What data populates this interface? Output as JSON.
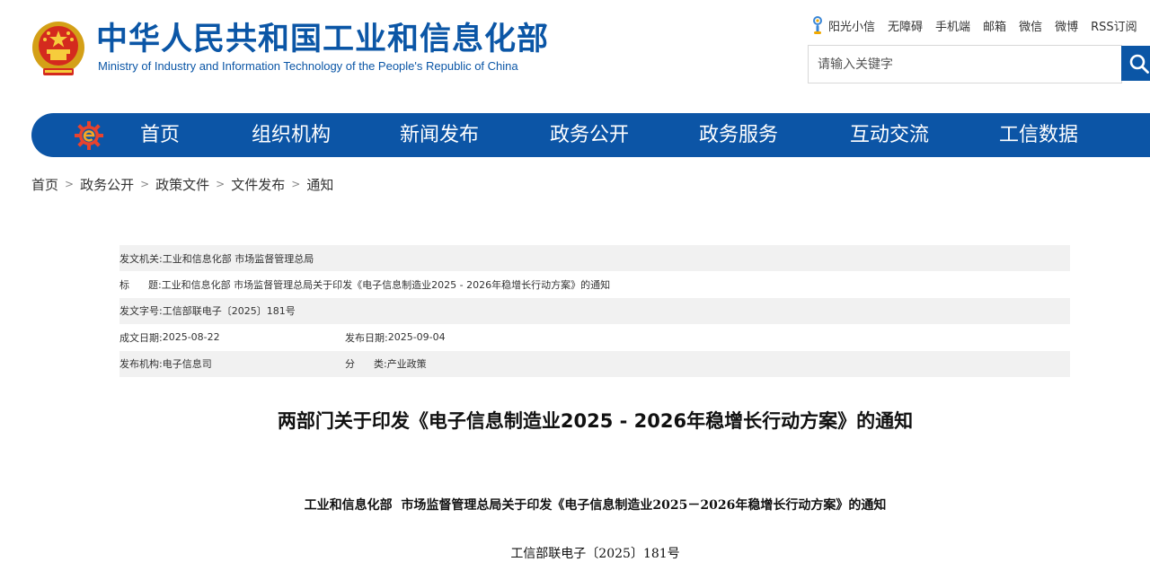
{
  "header": {
    "title": "中华人民共和国工业和信息化部",
    "subtitle": "Ministry of Industry and Information Technology of the People's Republic of China",
    "brand_color": "#0b56a6",
    "emblem_icon": "national-emblem-icon"
  },
  "top_links": [
    {
      "label": "阳光小信",
      "icon": "sun-mascot-icon"
    },
    {
      "label": "无障碍"
    },
    {
      "label": "手机端"
    },
    {
      "label": "邮箱"
    },
    {
      "label": "微信"
    },
    {
      "label": "微博"
    },
    {
      "label": "RSS订阅"
    }
  ],
  "search": {
    "placeholder": "请输入关键字",
    "value": "",
    "button_icon": "search-icon"
  },
  "nav": {
    "logo_icon": "e-gear-logo-icon",
    "background": "#0c55a6",
    "items": [
      {
        "label": "首页"
      },
      {
        "label": "组织机构"
      },
      {
        "label": "新闻发布"
      },
      {
        "label": "政务公开"
      },
      {
        "label": "政务服务"
      },
      {
        "label": "互动交流"
      },
      {
        "label": "工信数据"
      }
    ]
  },
  "breadcrumb": {
    "separator": ">",
    "items": [
      "首页",
      "政务公开",
      "政策文件",
      "文件发布",
      "通知"
    ]
  },
  "meta": {
    "issuer_key": "发文机关:",
    "issuer_value": "工业和信息化部 市场监督管理总局",
    "title_key": "标      题:",
    "title_value": "工业和信息化部 市场监督管理总局关于印发《电子信息制造业2025 - 2026年稳增长行动方案》的通知",
    "doc_no_key": "发文字号:",
    "doc_no_value": "工信部联电子〔2025〕181号",
    "created_key": "成文日期:",
    "created_value": "2025-08-22",
    "published_key": "发布日期:",
    "published_value": "2025-09-04",
    "org_key": "发布机构:",
    "org_value": "电子信息司",
    "category_key": "分      类:",
    "category_value": "产业政策"
  },
  "article": {
    "title": "两部门关于印发《电子信息制造业2025 - 2026年稳增长行动方案》的通知",
    "subtitle": "工业和信息化部  市场监督管理总局关于印发《电子信息制造业2025－2026年稳增长行动方案》的通知",
    "doc_no": "工信部联电子〔2025〕181号"
  }
}
